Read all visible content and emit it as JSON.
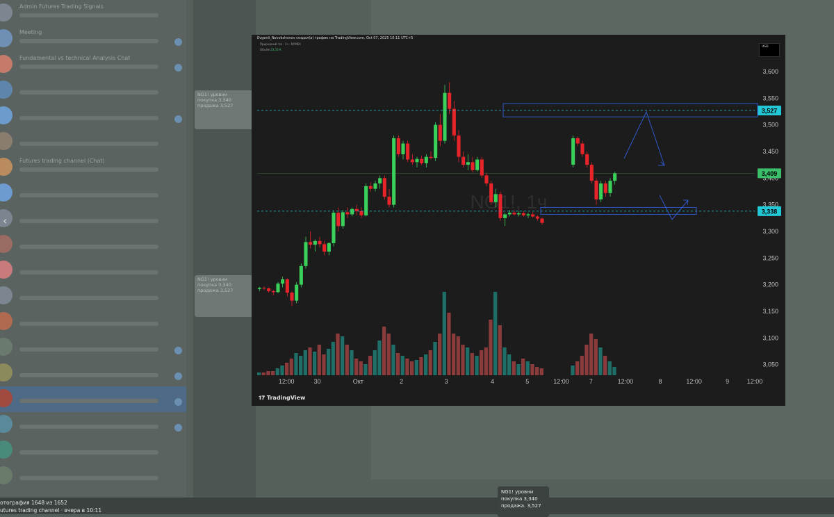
{
  "chat_list": {
    "items": [
      {
        "title": "Admin Futures Trading Signals",
        "time": "",
        "color": "#7c8691",
        "badge": false,
        "active": false
      },
      {
        "title": "Meeting",
        "time": "",
        "color": "#6f8fb5",
        "badge": true,
        "active": false
      },
      {
        "title": "Fundamental vs technical Analysis Chat",
        "time": "",
        "color": "#c47b6b",
        "badge": true,
        "active": false
      },
      {
        "title": "",
        "time": "",
        "color": "#5e86ad",
        "badge": false,
        "active": false
      },
      {
        "title": "",
        "time": "",
        "color": "#6c9ccc",
        "badge": true,
        "active": false
      },
      {
        "title": "",
        "time": "",
        "color": "#8a7d6e",
        "badge": false,
        "active": false
      },
      {
        "title": "Futures trading channel (Chat)",
        "time": "",
        "color": "#b98b5e",
        "badge": false,
        "active": false
      },
      {
        "title": "",
        "time": "",
        "color": "#6d9bd1",
        "badge": false,
        "active": false
      },
      {
        "title": "",
        "time": "",
        "color": "#7a8590",
        "badge": false,
        "active": false
      },
      {
        "title": "",
        "time": "",
        "color": "#9a6b62",
        "badge": false,
        "active": false
      },
      {
        "title": "",
        "time": "",
        "color": "#c97a7a",
        "badge": false,
        "active": false
      },
      {
        "title": "",
        "time": "",
        "color": "#7c8691",
        "badge": false,
        "active": false
      },
      {
        "title": "",
        "time": "",
        "color": "#b06a50",
        "badge": false,
        "active": false
      },
      {
        "title": "",
        "time": "",
        "color": "#6a7a6e",
        "badge": true,
        "active": false
      },
      {
        "title": "",
        "time": "",
        "color": "#8a8a5a",
        "badge": true,
        "active": false
      },
      {
        "title": "",
        "time": "",
        "color": "#a04a40",
        "badge": true,
        "active": true
      },
      {
        "title": "",
        "time": "",
        "color": "#5a8a9a",
        "badge": true,
        "active": false
      },
      {
        "title": "",
        "time": "",
        "color": "#4a8a7a",
        "badge": false,
        "active": false
      },
      {
        "title": "",
        "time": "",
        "color": "#6a7a6a",
        "badge": false,
        "active": false
      }
    ],
    "nav_arrow": "‹"
  },
  "mid_cards": [
    {
      "lines": [
        "NG1! уровни",
        "покупка 3,340",
        "продажа 3,527"
      ]
    }
  ],
  "chart_window": {
    "header": "Evgenii_Novokshonov создал(а) график на TradingView.com, Oct 07, 2025 10:11 UTC+5",
    "sub": "Природный газ · 1ч · NYMEX",
    "volume_label": "Объём",
    "volume_value": "23,33 К",
    "usd_label": "USD",
    "tv_logo": "TradingView",
    "watermark_main": "NG1!, 1ч",
    "watermark_sub": ""
  },
  "chart_data": {
    "type": "candlestick",
    "symbol": "NG1!",
    "timeframe": "1ч",
    "currency": "USD",
    "ylim": [
      3.03,
      3.63
    ],
    "y_ticks": [
      "3,600",
      "3,550",
      "3,500",
      "3,450",
      "3,400",
      "3,350",
      "3,300",
      "3,250",
      "3,200",
      "3,150",
      "3,100",
      "3,050"
    ],
    "x_ticks": [
      {
        "label": "12:00",
        "pos": 0.059
      },
      {
        "label": "30",
        "pos": 0.121
      },
      {
        "label": "Окт",
        "pos": 0.203
      },
      {
        "label": "2",
        "pos": 0.29
      },
      {
        "label": "3",
        "pos": 0.38
      },
      {
        "label": "4",
        "pos": 0.473
      },
      {
        "label": "5",
        "pos": 0.543
      },
      {
        "label": "12:00",
        "pos": 0.611
      },
      {
        "label": "7",
        "pos": 0.671
      },
      {
        "label": "12:00",
        "pos": 0.74
      },
      {
        "label": "8",
        "pos": 0.81
      },
      {
        "label": "12:00",
        "pos": 0.878
      },
      {
        "label": "9",
        "pos": 0.945
      },
      {
        "label": "12:00",
        "pos": 1.0
      }
    ],
    "price_labels": [
      {
        "value": 3.527,
        "text": "3,527",
        "color": "#22c8d6"
      },
      {
        "value": 3.409,
        "text": "3,409",
        "color": "#3bbf6a"
      },
      {
        "value": 3.338,
        "text": "3,338",
        "color": "#22c8d6"
      }
    ],
    "levels": [
      3.527,
      3.338
    ],
    "last_price": 3.409,
    "ohlc": [
      [
        3.192,
        3.196,
        3.188,
        3.194
      ],
      [
        3.194,
        3.197,
        3.19,
        3.193
      ],
      [
        3.193,
        3.195,
        3.185,
        3.188
      ],
      [
        3.188,
        3.19,
        3.18,
        3.186
      ],
      [
        3.186,
        3.205,
        3.184,
        3.202
      ],
      [
        3.202,
        3.215,
        3.195,
        3.21
      ],
      [
        3.21,
        3.212,
        3.178,
        3.185
      ],
      [
        3.185,
        3.188,
        3.16,
        3.17
      ],
      [
        3.17,
        3.205,
        3.165,
        3.2
      ],
      [
        3.2,
        3.24,
        3.195,
        3.235
      ],
      [
        3.235,
        3.29,
        3.23,
        3.28
      ],
      [
        3.28,
        3.3,
        3.268,
        3.275
      ],
      [
        3.275,
        3.285,
        3.262,
        3.282
      ],
      [
        3.282,
        3.29,
        3.27,
        3.276
      ],
      [
        3.276,
        3.282,
        3.255,
        3.262
      ],
      [
        3.262,
        3.28,
        3.255,
        3.278
      ],
      [
        3.278,
        3.34,
        3.272,
        3.335
      ],
      [
        3.335,
        3.345,
        3.3,
        3.31
      ],
      [
        3.31,
        3.34,
        3.305,
        3.336
      ],
      [
        3.336,
        3.345,
        3.325,
        3.332
      ],
      [
        3.332,
        3.345,
        3.328,
        3.342
      ],
      [
        3.342,
        3.35,
        3.33,
        3.338
      ],
      [
        3.338,
        3.345,
        3.325,
        3.33
      ],
      [
        3.33,
        3.39,
        3.328,
        3.385
      ],
      [
        3.385,
        3.392,
        3.375,
        3.38
      ],
      [
        3.38,
        3.395,
        3.375,
        3.39
      ],
      [
        3.39,
        3.405,
        3.38,
        3.4
      ],
      [
        3.4,
        3.405,
        3.36,
        3.365
      ],
      [
        3.365,
        3.38,
        3.345,
        3.35
      ],
      [
        3.35,
        3.48,
        3.345,
        3.475
      ],
      [
        3.475,
        3.48,
        3.44,
        3.445
      ],
      [
        3.445,
        3.47,
        3.435,
        3.465
      ],
      [
        3.465,
        3.47,
        3.43,
        3.435
      ],
      [
        3.435,
        3.445,
        3.425,
        3.43
      ],
      [
        3.43,
        3.44,
        3.42,
        3.436
      ],
      [
        3.436,
        3.442,
        3.425,
        3.428
      ],
      [
        3.428,
        3.445,
        3.42,
        3.44
      ],
      [
        3.44,
        3.45,
        3.435,
        3.438
      ],
      [
        3.438,
        3.505,
        3.432,
        3.5
      ],
      [
        3.5,
        3.52,
        3.46,
        3.47
      ],
      [
        3.47,
        3.575,
        3.465,
        3.56
      ],
      [
        3.56,
        3.58,
        3.52,
        3.53
      ],
      [
        3.53,
        3.545,
        3.47,
        3.48
      ],
      [
        3.48,
        3.49,
        3.43,
        3.44
      ],
      [
        3.44,
        3.45,
        3.42,
        3.425
      ],
      [
        3.425,
        3.445,
        3.415,
        3.43
      ],
      [
        3.43,
        3.44,
        3.41,
        3.415
      ],
      [
        3.415,
        3.44,
        3.412,
        3.435
      ],
      [
        3.435,
        3.44,
        3.4,
        3.405
      ],
      [
        3.405,
        3.41,
        3.385,
        3.39
      ],
      [
        3.39,
        3.395,
        3.35,
        3.355
      ],
      [
        3.355,
        3.38,
        3.345,
        3.37
      ],
      [
        3.37,
        3.375,
        3.32,
        3.325
      ],
      [
        3.325,
        3.335,
        3.31,
        3.332
      ],
      [
        3.332,
        3.34,
        3.328,
        3.335
      ],
      [
        3.335,
        3.34,
        3.33,
        3.332
      ],
      [
        3.332,
        3.338,
        3.328,
        3.334
      ],
      [
        3.334,
        3.338,
        3.328,
        3.33
      ],
      [
        3.33,
        3.335,
        3.325,
        3.332
      ],
      [
        3.332,
        3.336,
        3.326,
        3.328
      ],
      [
        3.328,
        3.33,
        3.32,
        3.324
      ],
      [
        3.324,
        3.326,
        3.312,
        3.316
      ],
      [
        3.425,
        3.48,
        3.42,
        3.475
      ],
      [
        3.475,
        3.478,
        3.46,
        3.465
      ],
      [
        3.465,
        3.47,
        3.44,
        3.445
      ],
      [
        3.445,
        3.45,
        3.42,
        3.425
      ],
      [
        3.425,
        3.43,
        3.39,
        3.395
      ],
      [
        3.395,
        3.4,
        3.35,
        3.36
      ],
      [
        3.36,
        3.395,
        3.355,
        3.39
      ],
      [
        3.39,
        3.395,
        3.365,
        3.372
      ],
      [
        3.372,
        3.4,
        3.365,
        3.395
      ],
      [
        3.395,
        3.412,
        3.388,
        3.409
      ]
    ],
    "volume": [
      2,
      2,
      3,
      3,
      5,
      7,
      9,
      12,
      16,
      14,
      18,
      20,
      17,
      22,
      15,
      19,
      24,
      30,
      28,
      22,
      18,
      12,
      10,
      8,
      14,
      18,
      25,
      35,
      30,
      22,
      16,
      14,
      12,
      10,
      11,
      13,
      15,
      18,
      24,
      30,
      60,
      45,
      30,
      28,
      22,
      20,
      16,
      14,
      18,
      20,
      40,
      60,
      36,
      20,
      15,
      10,
      8,
      12,
      10,
      8,
      6,
      5,
      7,
      10,
      14,
      22,
      30,
      26,
      20,
      14,
      10,
      6
    ],
    "xlabel": "",
    "ylabel": ""
  },
  "caption_box": {
    "lines": [
      "NG1! уровни",
      "покупка 3,340",
      "продажа. 3,527"
    ]
  },
  "bottom_bar": {
    "photo_counter": "отография 1648 из 1652",
    "channel_line": "utures trading channel · вчера в 10:11"
  }
}
